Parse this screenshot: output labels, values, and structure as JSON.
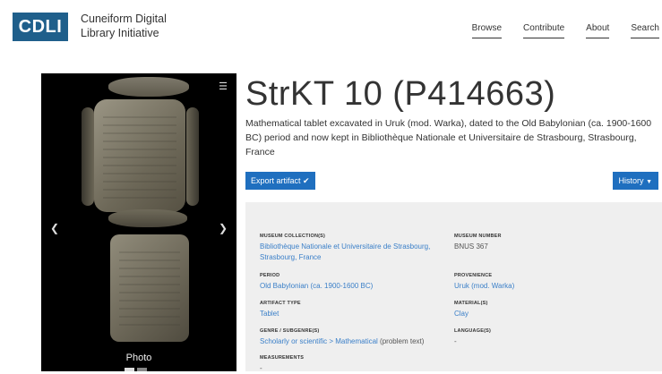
{
  "header": {
    "logo": "CDLI",
    "title_line1": "Cuneiform Digital",
    "title_line2": "Library Initiative",
    "nav": [
      "Browse",
      "Contribute",
      "About",
      "Search"
    ]
  },
  "viewer": {
    "photo_label": "Photo",
    "menu_icon": "hamburger-menu-icon",
    "prev_icon": "chevron-left-icon",
    "next_icon": "chevron-right-icon",
    "image_count": 2,
    "active_image": 1
  },
  "artifact": {
    "title": "StrKT 10 (P414663)",
    "description": "Mathematical tablet excavated in Uruk (mod. Warka), dated to the Old Babylonian (ca. 1900-1600 BC) period and now kept in Bibliothèque Nationale et Universitaire de Strasbourg, Strasbourg, France",
    "export_label": "Export artifact",
    "history_label": "History"
  },
  "fields": {
    "museum_collection_label": "MUSEUM COLLECTION(S)",
    "museum_collection_value": "Bibliothèque Nationale et Universitaire de Strasbourg, Strasbourg, France",
    "museum_number_label": "MUSEUM NUMBER",
    "museum_number_value": "BNUS 367",
    "period_label": "PERIOD",
    "period_value": "Old Babylonian (ca. 1900-1600 BC)",
    "provenience_label": "PROVENIENCE",
    "provenience_value": "Uruk (mod. Warka)",
    "artifact_type_label": "ARTIFACT TYPE",
    "artifact_type_value": "Tablet",
    "material_label": "MATERIAL(S)",
    "material_value": "Clay",
    "genre_label": "GENRE / SUBGENRE(S)",
    "genre_value_link": "Scholarly or scientific > Mathematical",
    "genre_value_suffix": " (problem text)",
    "language_label": "LANGUAGE(S)",
    "language_value": "-",
    "measurements_label": "MEASUREMENTS",
    "measurements_value": "-"
  },
  "colors": {
    "brand": "#1f5f8b",
    "button": "#1f6fbf",
    "link": "#3a7fc8",
    "panel_bg": "#efefef"
  }
}
